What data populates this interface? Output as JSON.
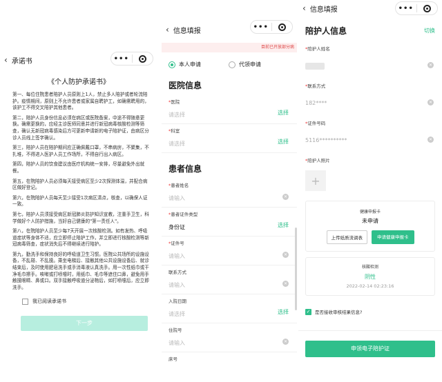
{
  "panel1": {
    "title": "承诺书",
    "doc_title": "《个人防护承诺书》",
    "paragraphs": [
      "第一、每位住院患者陪护人员原则上1人，禁止多人陪护或者轮流陪护。疫情期间，原则上不允许患者或家属自聘护工，如确需聘用的，该护工不得交叉陪护其他患者。",
      "第二，陪护人员身份信息必须在病区或医院备案，中途不得随意更换。确需更换的，应经主诊医师同意并进行新冠病毒核酸检测等筛查，确认无新冠病毒感染后方可更新申请新的电子陪护证，由病区分诊人员线上签字确认。",
      "第三，陪护人员在陪护期间应正确佩戴口罩，不串病房，不聚集，不扎堆，不得进入医护人员工作场所，不得自行出入病区。",
      "第四，陪护人员的饮食建议由医疗机构统一安排，尽量避免外出就餐。",
      "第五，在院陪护人员必须每天接受病区至少2次探测体温，并配合病区做好登记。",
      "第六，在院陪护人员每天至少接受1次病区清点，核查，以确保人证一致。",
      "第七，陪护人员须接受病区新冠肺炎防护知识宣教，注重手卫生，科学做好个人防护措施，当好自己健康的\"第一责任人\"。",
      "第八，在院陪护人员至少每7天开展一次核酸检测。如有发热、呼吸道症状等身体不适，应立即停止陪护工作，并立即进行核酸检测等新冠病毒筛查，症状消失后不得继续进行陪护。",
      "第九，勤洗手和保持良好的呼吸道卫生习惯。医院公共场所的设施设备，不乱碰、不乱摸。乘坐电梯后、接触其他公共设施设备后、就诊结束后，及时使用肥皂洗手或手消毒液认真洗手。用一次性纸巾或干净毛巾擦手。咳嗽或打喷嚏时，用纸巾、毛巾等遮住口鼻，避免用手触摸眼睛、鼻或口。双手接触呼吸道分泌物后，如打喷嚏后，应立即洗手。"
    ],
    "agree_label": "我已阅读承诺书",
    "next_label": "下一步"
  },
  "panel2": {
    "title": "信息填报",
    "banner": "目前已开放部分病",
    "radio_self": "本人申请",
    "radio_proxy": "代领申请",
    "section_hospital": "医院信息",
    "hospital_label": "医院",
    "dept_label": "科室",
    "placeholder_choose": "请选择",
    "choose_label": "选择",
    "section_patient": "患者信息",
    "patient_name_label": "患者姓名",
    "placeholder_input": "请输入",
    "id_type_label": "患者证件类型",
    "id_type_value": "身份证",
    "id_no_label": "证件号",
    "contact_label": "联系方式",
    "admit_date_label": "入院日期",
    "hosp_no_label": "住院号",
    "bed_no_label": "床号"
  },
  "panel3": {
    "title": "信息填报",
    "heading": "陪护人信息",
    "switch_label": "切换",
    "name_label": "陪护人姓名",
    "contact_label": "联系方式",
    "contact_value": "182****",
    "id_label": "证件号码",
    "id_value": "5116**********",
    "photo_label": "陪护人照片",
    "health_card_title": "健康申报卡",
    "health_card_status": "未申请",
    "upload_label": "上传纸质流调表",
    "apply_card_label": "申请健康申报卡",
    "nucleic_title": "核酸检测",
    "nucleic_result": "阴性",
    "nucleic_time": "2022-02-14 02:23:16",
    "sms_label": "是否接收审核结果信息?",
    "apply_btn": "申领电子陪护证"
  }
}
